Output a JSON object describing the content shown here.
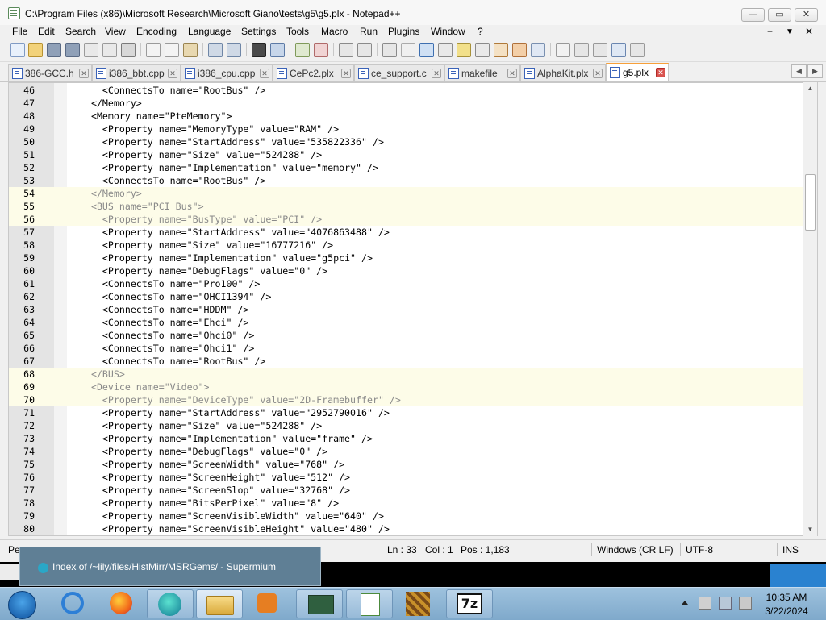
{
  "window": {
    "title": "C:\\Program Files (x86)\\Microsoft Research\\Microsoft Giano\\tests\\g5\\g5.plx - Notepad++",
    "min_icon": "minimize-icon",
    "max_icon": "maximize-icon",
    "close_icon": "close-icon",
    "min_glyph": "—",
    "max_glyph": "▭",
    "close_glyph": "✕"
  },
  "menu": {
    "items": [
      "File",
      "Edit",
      "Search",
      "View",
      "Encoding",
      "Language",
      "Settings",
      "Tools",
      "Macro",
      "Run",
      "Plugins",
      "Window",
      "?"
    ],
    "right_glyphs": [
      "+",
      "▼",
      "✕"
    ]
  },
  "tabs": [
    {
      "label": "386-GCC.h",
      "active": false
    },
    {
      "label": "i386_bbt.cpp",
      "active": false
    },
    {
      "label": "i386_cpu.cpp",
      "active": false
    },
    {
      "label": "CePc2.plx",
      "active": false
    },
    {
      "label": "ce_support.c",
      "active": false
    },
    {
      "label": "makefile",
      "active": false
    },
    {
      "label": "AlphaKit.plx",
      "active": false
    },
    {
      "label": "g5.plx",
      "active": true
    }
  ],
  "tab_close_glyph": "✕",
  "tab_scroll": {
    "left": "◀",
    "right": "▶"
  },
  "editor": {
    "lines": [
      {
        "n": "46",
        "text": "    <ConnectsTo name=\"RootBus\" />",
        "dim": false,
        "hl": false
      },
      {
        "n": "47",
        "text": "  </Memory>",
        "dim": false,
        "hl": false
      },
      {
        "n": "48",
        "text": "  <Memory name=\"PteMemory\">",
        "dim": false,
        "hl": false
      },
      {
        "n": "49",
        "text": "    <Property name=\"MemoryType\" value=\"RAM\" />",
        "dim": false,
        "hl": false
      },
      {
        "n": "50",
        "text": "    <Property name=\"StartAddress\" value=\"535822336\" />",
        "dim": false,
        "hl": false
      },
      {
        "n": "51",
        "text": "    <Property name=\"Size\" value=\"524288\" />",
        "dim": false,
        "hl": false
      },
      {
        "n": "52",
        "text": "    <Property name=\"Implementation\" value=\"memory\" />",
        "dim": false,
        "hl": false
      },
      {
        "n": "53",
        "text": "    <ConnectsTo name=\"RootBus\" />",
        "dim": false,
        "hl": false
      },
      {
        "n": "54",
        "text": "  </Memory>",
        "dim": true,
        "hl": true
      },
      {
        "n": "55",
        "text": "  <BUS name=\"PCI Bus\">",
        "dim": true,
        "hl": true
      },
      {
        "n": "56",
        "text": "    <Property name=\"BusType\" value=\"PCI\" />",
        "dim": true,
        "hl": true
      },
      {
        "n": "57",
        "text": "    <Property name=\"StartAddress\" value=\"4076863488\" />",
        "dim": false,
        "hl": false
      },
      {
        "n": "58",
        "text": "    <Property name=\"Size\" value=\"16777216\" />",
        "dim": false,
        "hl": false
      },
      {
        "n": "59",
        "text": "    <Property name=\"Implementation\" value=\"g5pci\" />",
        "dim": false,
        "hl": false
      },
      {
        "n": "60",
        "text": "    <Property name=\"DebugFlags\" value=\"0\" />",
        "dim": false,
        "hl": false
      },
      {
        "n": "61",
        "text": "    <ConnectsTo name=\"Pro100\" />",
        "dim": false,
        "hl": false
      },
      {
        "n": "62",
        "text": "    <ConnectsTo name=\"OHCI1394\" />",
        "dim": false,
        "hl": false
      },
      {
        "n": "63",
        "text": "    <ConnectsTo name=\"HDDM\" />",
        "dim": false,
        "hl": false
      },
      {
        "n": "64",
        "text": "    <ConnectsTo name=\"Ehci\" />",
        "dim": false,
        "hl": false
      },
      {
        "n": "65",
        "text": "    <ConnectsTo name=\"Ohci0\" />",
        "dim": false,
        "hl": false
      },
      {
        "n": "66",
        "text": "    <ConnectsTo name=\"Ohci1\" />",
        "dim": false,
        "hl": false
      },
      {
        "n": "67",
        "text": "    <ConnectsTo name=\"RootBus\" />",
        "dim": false,
        "hl": false
      },
      {
        "n": "68",
        "text": "  </BUS>",
        "dim": true,
        "hl": true
      },
      {
        "n": "69",
        "text": "  <Device name=\"Video\">",
        "dim": true,
        "hl": true
      },
      {
        "n": "70",
        "text": "    <Property name=\"DeviceType\" value=\"2D-Framebuffer\" />",
        "dim": true,
        "hl": true
      },
      {
        "n": "71",
        "text": "    <Property name=\"StartAddress\" value=\"2952790016\" />",
        "dim": false,
        "hl": false
      },
      {
        "n": "72",
        "text": "    <Property name=\"Size\" value=\"524288\" />",
        "dim": false,
        "hl": false
      },
      {
        "n": "73",
        "text": "    <Property name=\"Implementation\" value=\"frame\" />",
        "dim": false,
        "hl": false
      },
      {
        "n": "74",
        "text": "    <Property name=\"DebugFlags\" value=\"0\" />",
        "dim": false,
        "hl": false
      },
      {
        "n": "75",
        "text": "    <Property name=\"ScreenWidth\" value=\"768\" />",
        "dim": false,
        "hl": false
      },
      {
        "n": "76",
        "text": "    <Property name=\"ScreenHeight\" value=\"512\" />",
        "dim": false,
        "hl": false
      },
      {
        "n": "77",
        "text": "    <Property name=\"ScreenSlop\" value=\"32768\" />",
        "dim": false,
        "hl": false
      },
      {
        "n": "78",
        "text": "    <Property name=\"BitsPerPixel\" value=\"8\" />",
        "dim": false,
        "hl": false
      },
      {
        "n": "79",
        "text": "    <Property name=\"ScreenVisibleWidth\" value=\"640\" />",
        "dim": false,
        "hl": false
      },
      {
        "n": "80",
        "text": "    <Property name=\"ScreenVisibleHeight\" value=\"480\" />",
        "dim": false,
        "hl": false
      }
    ]
  },
  "status": {
    "left": "Pe",
    "ln": "Ln : 33",
    "col": "Col : 1",
    "pos": "Pos : 1,183",
    "eol": "Windows (CR LF)",
    "encoding": "UTF-8",
    "mode": "INS"
  },
  "preview": {
    "title": "Index of /~lily/files/HistMirr/MSRGems/ - Supermium"
  },
  "taskbar": {
    "items": [
      "start",
      "ie",
      "firefox",
      "supermium",
      "explorer",
      "media",
      "app-monitor",
      "notepadpp",
      "game",
      "7zip"
    ],
    "sevenzip_label": "7z"
  },
  "clock": {
    "time": "10:35 AM",
    "date": "3/22/2024"
  },
  "colors": {
    "accent": "#f7a03a",
    "taskbar": "#8fb6d6",
    "editor_highlight": "#fdfce8"
  }
}
